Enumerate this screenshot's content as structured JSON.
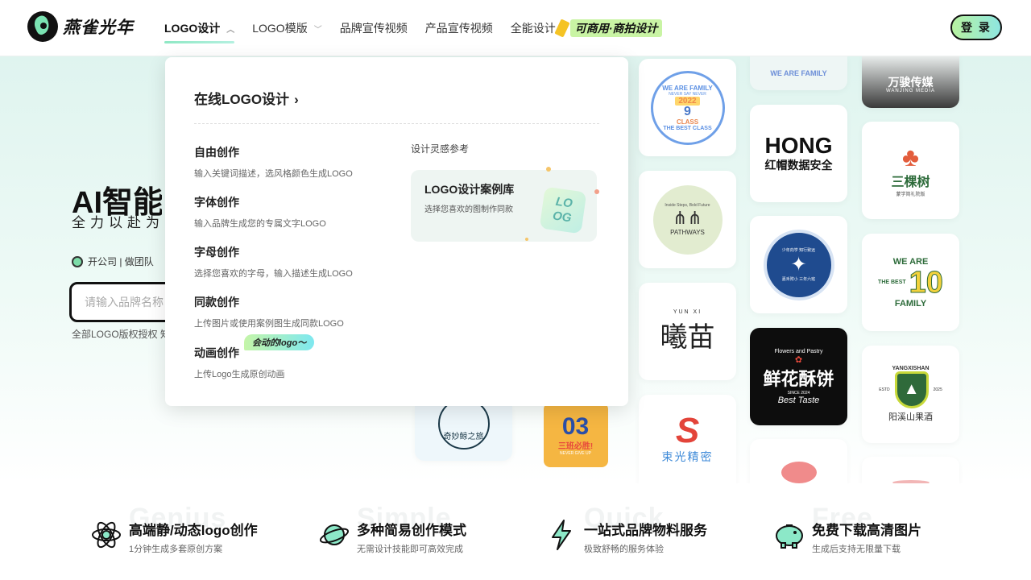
{
  "header": {
    "logo_text": "燕雀光年",
    "nav": [
      {
        "label": "LOGO设计",
        "has_chevron": true
      },
      {
        "label": "LOGO模版",
        "has_chevron": true
      },
      {
        "label": "品牌宣传视频"
      },
      {
        "label": "产品宣传视频"
      },
      {
        "label": "全能设计",
        "promo": "可商用·商拍设计"
      }
    ],
    "login": "登 录"
  },
  "hero": {
    "title": "AI智能",
    "subtitle": "全力以赴为",
    "tagline": "开公司 | 做团队",
    "search_placeholder": "请输入品牌名称",
    "note": "全部LOGO版权授权 知"
  },
  "dropdown": {
    "heading": "在线LOGO设计",
    "items": [
      {
        "name": "自由创作",
        "desc": "输入关键词描述，选风格颜色生成LOGO"
      },
      {
        "name": "字体创作",
        "desc": "输入品牌生成您的专属文字LOGO"
      },
      {
        "name": "字母创作",
        "desc": "选择您喜欢的字母，输入描述生成LOGO"
      },
      {
        "name": "同款创作",
        "desc": "上传图片或使用案例图生成同款LOGO"
      },
      {
        "name": "动画创作",
        "desc": "上传Logo生成原创动画"
      }
    ],
    "badge": "会动的logo～",
    "ref_title": "设计灵感参考",
    "case": {
      "title": "LOGO设计案例库",
      "desc": "选择您喜欢的图制作同款",
      "tile_line1": "LO",
      "tile_line2": "OG"
    }
  },
  "gallery": {
    "we_are_family": "WE ARE FAMILY",
    "never_say": "NEVER SAY NEVER",
    "year": "2022",
    "class_num": "9",
    "class": "CLASS",
    "best_class": "THE BEST CLASS",
    "wanjun_cn": "万骏传媒",
    "wanjun_en": "WANJING MEDIA",
    "hong": "HONG",
    "hong_sub": "红帽数据安全",
    "three_trees": "三棵树",
    "three_trees_sub": "蒙学简礼院版",
    "pathways": "PATHWAYS",
    "pathways_motto": "Inside Steps, Bold Future",
    "youth_badge": "少年向学 知行致远",
    "youth_badge_sub": "嘉禾附小 三年六班",
    "xi_cn": "曦苗",
    "xi_en": "YUN XI",
    "flowers_top": "Flowers and Pastry",
    "flowers_cn": "鲜花酥饼",
    "flowers_since": "SINCE 2024",
    "flowers_best": "Best Taste",
    "family_10": "10",
    "family_top": "WE ARE",
    "family_bottom": "FAMILY",
    "family_left": "THE BEST",
    "yx_en": "YANGXISHAN",
    "yx_estd": "ESTD",
    "yx_year": "2025",
    "yx_cn": "阳溪山果酒",
    "whale": "奇妙鲸之旅",
    "zero3": "03",
    "zero3_sub": "三班必胜!",
    "zero3_tiny": "NEVER GIVE UP",
    "shuguang": "束光精密"
  },
  "features": [
    {
      "title": "高端静/动态logo创作",
      "desc": "1分钟生成多套原创方案",
      "ghost": "Genius",
      "icon": "atom-icon"
    },
    {
      "title": "多种简易创作模式",
      "desc": "无需设计技能即可高效完成",
      "ghost": "Simple",
      "icon": "planet-icon"
    },
    {
      "title": "一站式品牌物料服务",
      "desc": "极致舒畅的服务体验",
      "ghost": "Quick",
      "icon": "lightning-icon"
    },
    {
      "title": "免费下载高清图片",
      "desc": "生成后支持无限量下载",
      "ghost": "Free",
      "icon": "piggy-bank-icon"
    }
  ]
}
